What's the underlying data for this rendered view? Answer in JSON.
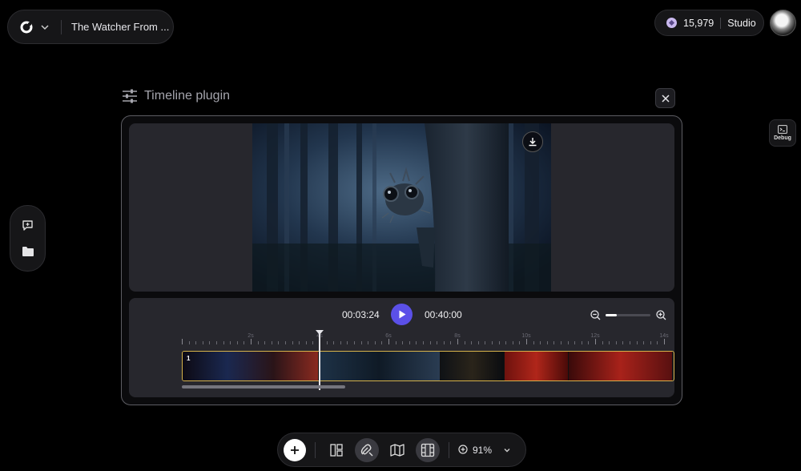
{
  "project": {
    "title": "The Watcher From ..."
  },
  "account": {
    "credits": "15,979",
    "plan_label": "Studio"
  },
  "debug": {
    "label": "Debug"
  },
  "plugin": {
    "title": "Timeline plugin"
  },
  "player": {
    "current_time": "00:03:24",
    "total_time": "00:40:00",
    "zoom_fraction": 0.25
  },
  "ruler": {
    "labels": [
      "2s",
      "4s",
      "6s",
      "8s",
      "10s",
      "12s",
      "14s"
    ]
  },
  "track": {
    "clips": [
      {
        "number": "1",
        "colors": [
          "#0d0a14",
          "#1a2850",
          "#2a1418",
          "#8a2a20"
        ]
      },
      {
        "number": "",
        "colors": [
          "#1e3247",
          "#0f1a26",
          "#2a3c52"
        ]
      },
      {
        "number": "",
        "colors": [
          "#0f1216",
          "#2a241a",
          "#0a0c10"
        ]
      },
      {
        "number": "",
        "colors": [
          "#6e120e",
          "#b0261a",
          "#4a0a08"
        ]
      },
      {
        "number": "",
        "colors": [
          "#3a0a0a",
          "#a8221a",
          "#581010"
        ]
      }
    ]
  },
  "toolbar": {
    "zoom_level": "91%"
  },
  "colors": {
    "accent": "#5b50e8",
    "track_border": "#d6b24a"
  }
}
